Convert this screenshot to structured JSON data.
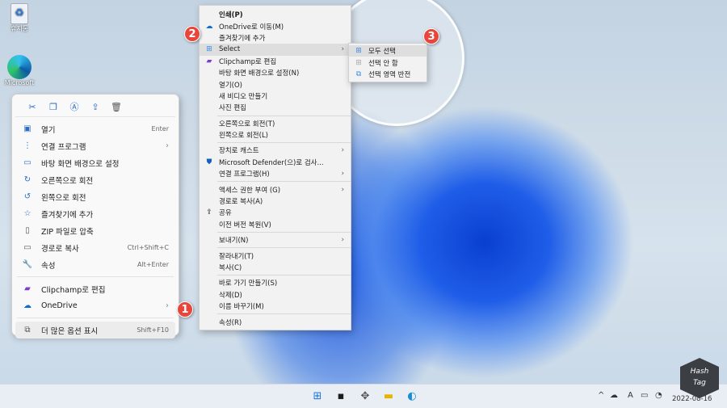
{
  "desktop": {
    "icons": [
      {
        "label": "휴지통",
        "icon": "recycle-bin-icon"
      },
      {
        "label": "Microsoft",
        "icon": "edge-icon"
      }
    ]
  },
  "modern_menu": {
    "toolbar": [
      "cut-icon",
      "copy-icon",
      "rename-icon",
      "share-icon",
      "delete-icon"
    ],
    "items": [
      {
        "label": "열기",
        "shortcut": "Enter",
        "icon": "image-icon"
      },
      {
        "label": "연결 프로그램",
        "submenu": true,
        "icon": "open-with-icon"
      },
      {
        "label": "바탕 화면 배경으로 설정",
        "icon": "wallpaper-icon"
      },
      {
        "label": "오른쪽으로 회전",
        "icon": "rotate-right-icon"
      },
      {
        "label": "왼쪽으로 회전",
        "icon": "rotate-left-icon"
      },
      {
        "label": "즐겨찾기에 추가",
        "icon": "star-icon"
      },
      {
        "label": "ZIP 파일로 압축",
        "icon": "zip-icon"
      },
      {
        "label": "경로로 복사",
        "shortcut": "Ctrl+Shift+C",
        "icon": "path-icon"
      },
      {
        "label": "속성",
        "shortcut": "Alt+Enter",
        "icon": "wrench-icon"
      },
      {
        "label": "Clipchamp로 편집",
        "icon": "clipchamp-icon"
      },
      {
        "label": "OneDrive",
        "submenu": true,
        "icon": "onedrive-icon"
      },
      {
        "label": "더 많은 옵션 표시",
        "shortcut": "Shift+F10",
        "icon": "more-options-icon"
      }
    ]
  },
  "classic_menu": {
    "items": [
      "인쇄(P)",
      "OneDrive로 이동(M)",
      "즐겨찾기에 추가",
      "Select",
      "Clipchamp로 편집",
      "바탕 화면 배경으로 설정(N)",
      "열기(O)",
      "새 비디오 만들기",
      "사진 편집",
      "오른쪽으로 회전(T)",
      "왼쪽으로 회전(L)",
      "장치로 캐스트",
      "Microsoft Defender(으)로 검사...",
      "연결 프로그램(H)",
      "액세스 권한 부여 (G)",
      "경로로 복사(A)",
      "공유",
      "이전 버전 복원(V)",
      "보내기(N)",
      "잘라내기(T)",
      "복사(C)",
      "바로 가기 만들기(S)",
      "삭제(D)",
      "이름 바꾸기(M)",
      "속성(R)"
    ]
  },
  "select_submenu": {
    "items": [
      "모두 선택",
      "선택 안 함",
      "선택 영역 반전"
    ]
  },
  "badges": [
    "1",
    "2",
    "3"
  ],
  "tray": {
    "date": "2022-08-16",
    "logo": "Hash Tag"
  },
  "colors": {
    "accent": "#2b6cc4",
    "badge": "#e8453c"
  }
}
